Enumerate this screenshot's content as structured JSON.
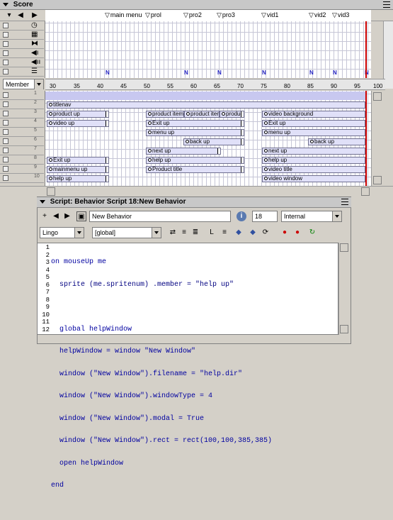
{
  "score": {
    "title": "Score",
    "markers": [
      "main menu",
      "prol",
      "pro2",
      "pro3",
      "vid1",
      "vid2",
      "vid3"
    ],
    "member_select": "Member",
    "frame_numbers": [
      "30",
      "35",
      "40",
      "45",
      "50",
      "55",
      "60",
      "65",
      "70",
      "75",
      "80",
      "85",
      "90",
      "95",
      "100"
    ],
    "channel_numbers": [
      "1",
      "2",
      "3",
      "4",
      "5",
      "6",
      "7",
      "8",
      "9",
      "10"
    ],
    "sprites": {
      "titlenav": "titlenav",
      "product_up": "product up",
      "product_item": "product item",
      "product_item2": "product iten",
      "produc": "produc",
      "video_background": "video background",
      "video_up": "video up",
      "exit_up_1": "Exit up",
      "exit_up_2": "Exit up",
      "menu_up_1": "menu up",
      "menu_up_2": "menu up",
      "back_up_1": "back up",
      "back_up_2": "back up",
      "next_up_1": "next up",
      "next_up_2": "next up",
      "exit_up_3": "Exit up",
      "help_up_1": "help up",
      "help_up_2": "help up",
      "help_up_3": "help up",
      "mainmenu_up": "mainmenu up",
      "product_title": "Product title",
      "video_title": "video title",
      "help_up_4": "help up",
      "video_window": "video window"
    }
  },
  "script_window": {
    "title": "Script: Behavior Script 18:New Behavior",
    "behavior_name": "New Behavior",
    "member_number": "18",
    "cast_select": "Internal",
    "language_select": "Lingo",
    "handler_select": "[global]",
    "line_numbers": [
      "1",
      "2",
      "3",
      "4",
      "5",
      "6",
      "7",
      "8",
      "9",
      "10",
      "11",
      "12"
    ],
    "code_lines": [
      "on mouseUp me",
      "  sprite (me.spritenum) .member = \"help up\"",
      "",
      "  global helpWindow",
      "  helpWindow = window \"New Window\"",
      "  window (\"New Window\").filename = \"help.dir\"",
      "  window (\"New Window\").windowType = 4",
      "  window (\"New Window\").modal = True",
      "  window (\"New Window\").rect = rect(100,100,385,385)",
      "  open helpWindow",
      "end",
      ""
    ]
  }
}
